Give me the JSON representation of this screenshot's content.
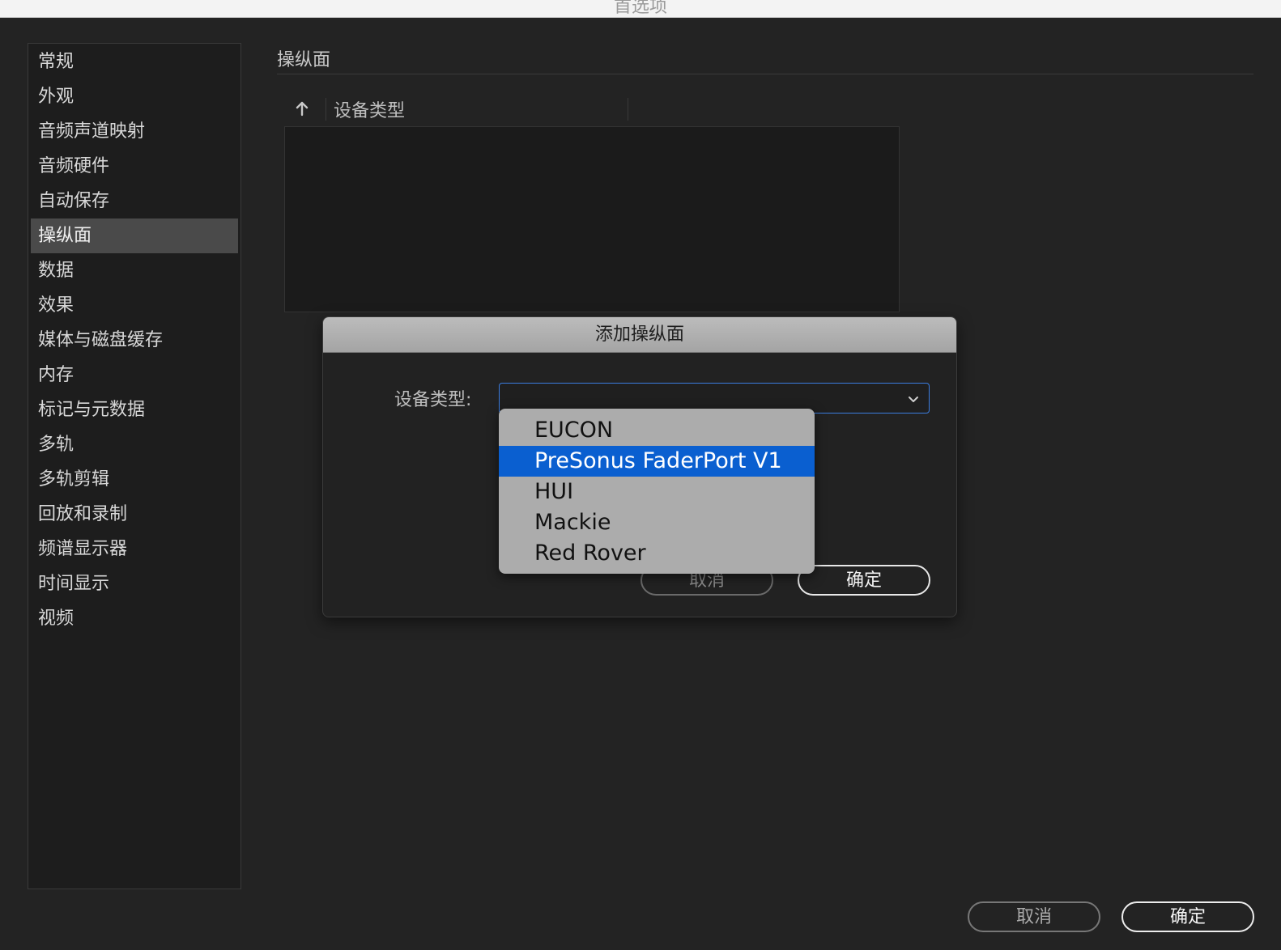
{
  "window": {
    "title": "首选项"
  },
  "sidebar": {
    "items": [
      {
        "label": "常规"
      },
      {
        "label": "外观"
      },
      {
        "label": "音频声道映射"
      },
      {
        "label": "音频硬件"
      },
      {
        "label": "自动保存"
      },
      {
        "label": "操纵面",
        "selected": true
      },
      {
        "label": "数据"
      },
      {
        "label": "效果"
      },
      {
        "label": "媒体与磁盘缓存"
      },
      {
        "label": "内存"
      },
      {
        "label": "标记与元数据"
      },
      {
        "label": "多轨"
      },
      {
        "label": "多轨剪辑"
      },
      {
        "label": "回放和录制"
      },
      {
        "label": "频谱显示器"
      },
      {
        "label": "时间显示"
      },
      {
        "label": "视频"
      }
    ]
  },
  "main": {
    "section_title": "操纵面",
    "table": {
      "column_header": "设备类型",
      "sort_icon": "arrow-up-icon"
    }
  },
  "dialog": {
    "title": "添加操纵面",
    "field_label": "设备类型:",
    "select_value": "",
    "dropdown_options": [
      {
        "label": "EUCON"
      },
      {
        "label": "PreSonus FaderPort V1",
        "highlighted": true
      },
      {
        "label": "HUI"
      },
      {
        "label": "Mackie"
      },
      {
        "label": "Red Rover"
      }
    ],
    "cancel_label": "取消",
    "ok_label": "确定"
  },
  "footer": {
    "cancel_label": "取消",
    "ok_label": "确定"
  },
  "colors": {
    "background": "#232323",
    "sidebar_selected": "#4a4a4a",
    "dropdown_bg": "#acacac",
    "dropdown_highlight": "#0a5fd0",
    "focus_border": "#3b7de0"
  }
}
